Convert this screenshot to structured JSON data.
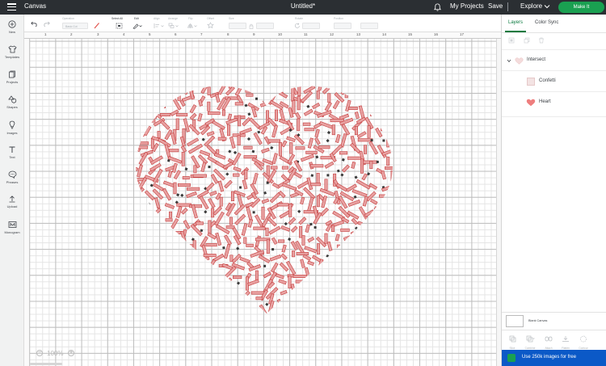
{
  "header": {
    "app_title": "Canvas",
    "doc_title": "Untitled*",
    "my_projects": "My Projects",
    "save": "Save",
    "explore": "Explore",
    "make_it": "Make It"
  },
  "sidebar": {
    "items": [
      {
        "label": "New",
        "icon": "plus-circle-icon"
      },
      {
        "label": "Templates",
        "icon": "shirt-icon"
      },
      {
        "label": "Projects",
        "icon": "projects-icon"
      },
      {
        "label": "Shapes",
        "icon": "shapes-icon"
      },
      {
        "label": "Images",
        "icon": "lightbulb-icon"
      },
      {
        "label": "Text",
        "icon": "text-icon"
      },
      {
        "label": "Phrases",
        "icon": "speech-bubble-icon"
      },
      {
        "label": "Upload",
        "icon": "upload-icon"
      },
      {
        "label": "Monogram",
        "icon": "monogram-icon"
      }
    ]
  },
  "toolbar": {
    "operation_label": "Operation",
    "operation_value": "Basic Cut",
    "select_all": "Select All",
    "edit": "Edit",
    "align": "Align",
    "arrange": "Arrange",
    "flip": "Flip",
    "offset": "Offset",
    "size": "Size",
    "rotate": "Rotate",
    "position": "Position"
  },
  "ruler": {
    "top": [
      "1",
      "2",
      "3",
      "4",
      "5",
      "6",
      "7",
      "8",
      "9",
      "10",
      "11",
      "12",
      "13",
      "14",
      "15",
      "16",
      "17"
    ]
  },
  "zoom": {
    "minus": "−",
    "value": "100%",
    "plus": "+"
  },
  "right_panel": {
    "tabs": [
      "Layers",
      "Color Sync"
    ],
    "layers": [
      {
        "name": "Intersect",
        "indent": 0
      },
      {
        "name": "Confetti",
        "indent": 1
      },
      {
        "name": "Heart",
        "indent": 1
      }
    ],
    "blank_canvas": "Blank Canvas",
    "bottom_tools": [
      "Slice",
      "Combine",
      "Attach",
      "Flatten",
      "Contour"
    ],
    "promo": "Use 250k images for free"
  },
  "colors": {
    "header_bg": "#2b2f33",
    "accent_green": "#1aa051",
    "confetti_fill": "#e8a1a1",
    "confetti_stroke": "#c43d3d",
    "promo_bg": "#0b59c7"
  }
}
